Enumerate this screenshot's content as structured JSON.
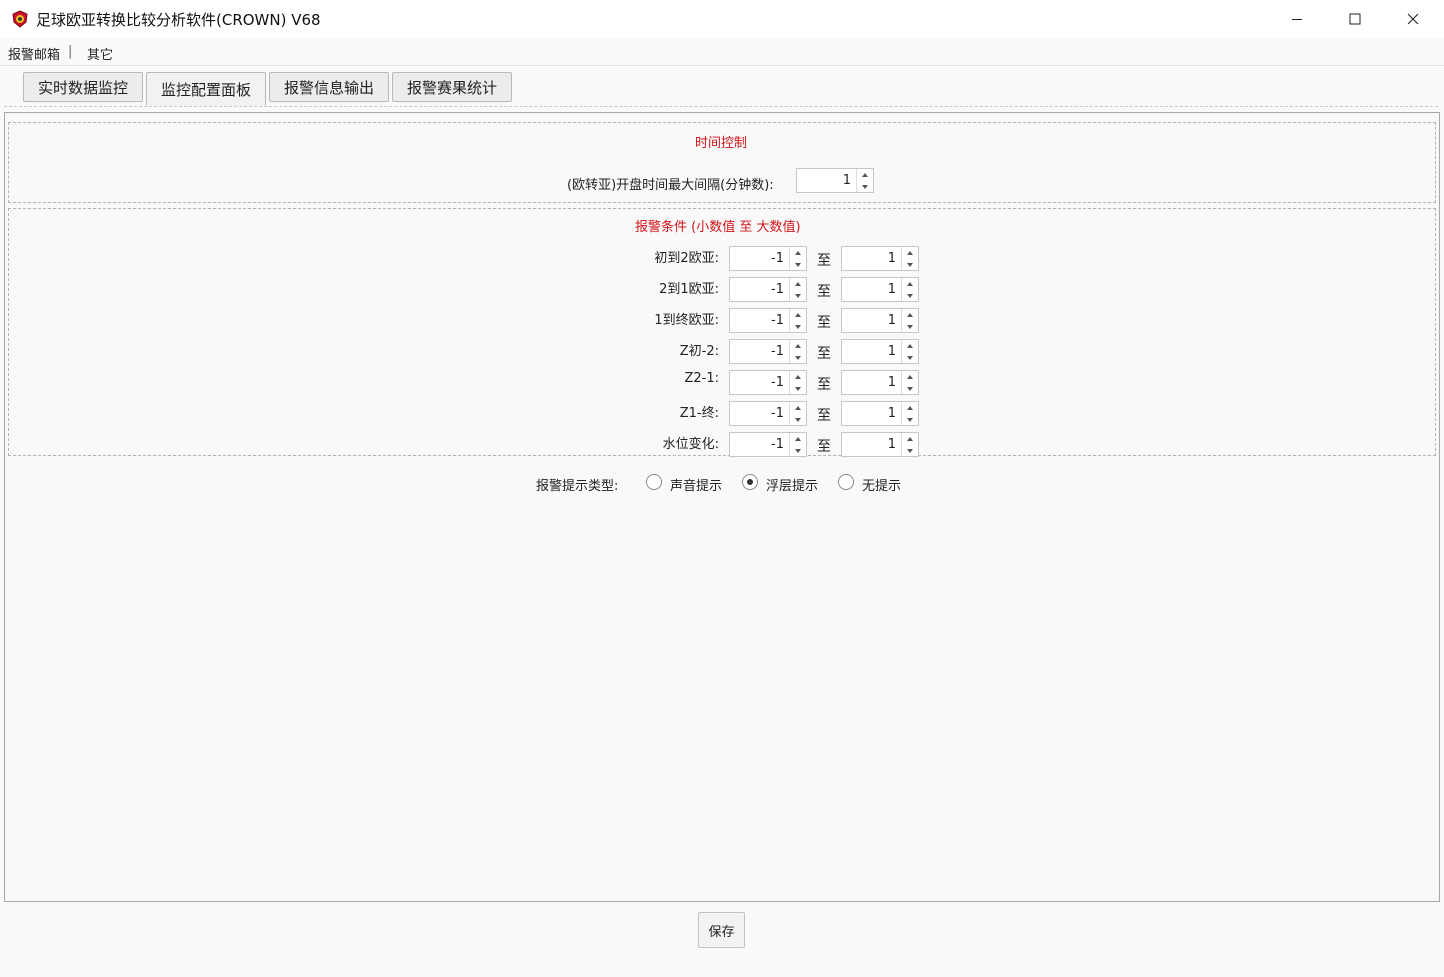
{
  "window": {
    "title": "足球欧亚转换比较分析软件(CROWN) V68",
    "icon": "app-logo-icon"
  },
  "menu": {
    "items": [
      "报警邮箱",
      "|",
      "其它"
    ]
  },
  "tabs": [
    {
      "label": "实时数据监控",
      "active": false
    },
    {
      "label": "监控配置面板",
      "active": true
    },
    {
      "label": "报警信息输出",
      "active": false
    },
    {
      "label": "报警赛果统计",
      "active": false
    }
  ],
  "time_control": {
    "title": "时间控制",
    "label": "(欧转亚)开盘时间最大间隔(分钟数):",
    "value": "1"
  },
  "alarm_conditions": {
    "title": "报警条件 (小数值 至 大数值)",
    "to_label": "至",
    "rows": [
      {
        "label": "初到2欧亚:",
        "min": "-1",
        "max": "1"
      },
      {
        "label": "2到1欧亚:",
        "min": "-1",
        "max": "1"
      },
      {
        "label": "1到终欧亚:",
        "min": "-1",
        "max": "1"
      },
      {
        "label": "Z初-2:",
        "min": "-1",
        "max": "1"
      },
      {
        "label": "Z2-1:",
        "min": "-1",
        "max": "1"
      },
      {
        "label": "Z1-终:",
        "min": "-1",
        "max": "1"
      },
      {
        "label": "水位变化:",
        "min": "-1",
        "max": "1"
      }
    ]
  },
  "alert_type": {
    "label": "报警提示类型:",
    "options": [
      {
        "label": "声音提示",
        "checked": false
      },
      {
        "label": "浮层提示",
        "checked": true
      },
      {
        "label": "无提示",
        "checked": false
      }
    ]
  },
  "save_label": "保存",
  "colors": {
    "section_title": "#d4141a",
    "background": "#f9f9f9"
  }
}
